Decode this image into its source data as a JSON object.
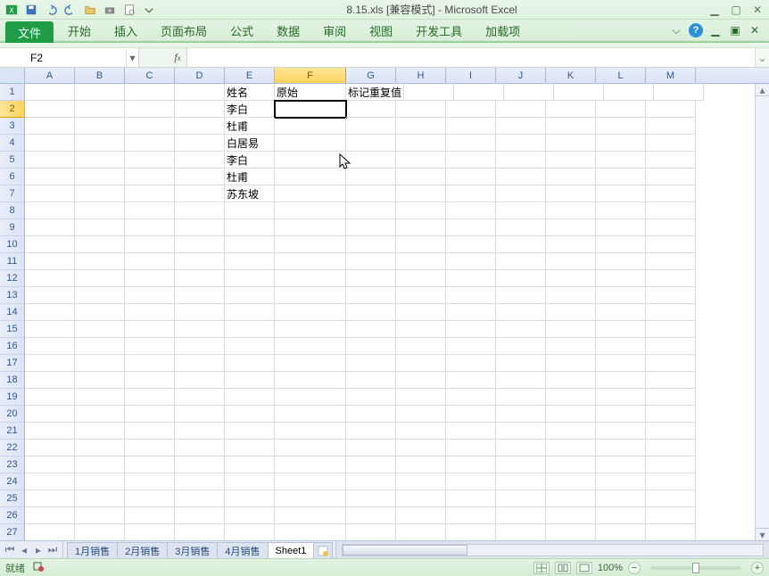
{
  "title": "8.15.xls [兼容模式] - Microsoft Excel",
  "ribbon": {
    "file": "文件",
    "tabs": [
      "开始",
      "插入",
      "页面布局",
      "公式",
      "数据",
      "审阅",
      "视图",
      "开发工具",
      "加载项"
    ]
  },
  "namebox": "F2",
  "formula": "",
  "columns": [
    "A",
    "B",
    "C",
    "D",
    "E",
    "F",
    "G",
    "H",
    "I",
    "J",
    "K",
    "L",
    "M"
  ],
  "active_col_index": 5,
  "row_count": 27,
  "active_row": 2,
  "cells": {
    "E1": "姓名",
    "F1": "原始",
    "G1": "标记重复值",
    "E2": "李白",
    "E3": "杜甫",
    "E4": "白居易",
    "E5": "李白",
    "E6": "杜甫",
    "E7": "苏东坡"
  },
  "sheet_tabs": [
    "1月销售",
    "2月销售",
    "3月销售",
    "4月销售",
    "Sheet1"
  ],
  "active_sheet": 4,
  "status": {
    "ready": "就绪",
    "zoom": "100%"
  }
}
